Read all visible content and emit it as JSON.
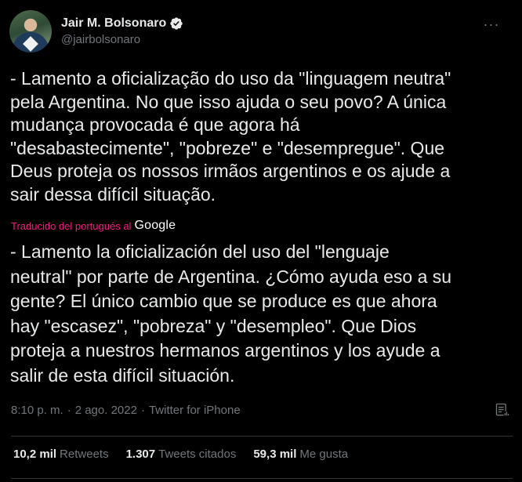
{
  "author": {
    "display_name": "Jair M. Bolsonaro",
    "handle": "@jairbolsonaro",
    "verified": true,
    "avatar_icon": "profile-photo"
  },
  "tweet": {
    "text": "- Lamento a oficialização do uso da \"linguagem neutra\"\npela Argentina. No que isso ajuda o seu povo? A única\nmudança provocada é que agora há\n\"desabastecimente\", \"pobreze\" e \"desempregue\". Que\nDeus proteja os nossos irmãos argentinos e os ajude a\nsair dessa difícil situação.",
    "translation_label": "Traducido del portugués al",
    "translation_provider": "Google",
    "translated_text": "- Lamento la oficialización del uso del \"lenguaje\nneutral\" por parte de Argentina. ¿Cómo ayuda eso a su\ngente? El único cambio que se produce es que ahora\nhay \"escasez\", \"pobreza\" y \"desempleo\". Que Dios\nproteja a nuestros hermanos argentinos y los ayude a\nsalir de esta difícil situación."
  },
  "meta": {
    "time": "8:10 p. m.",
    "separator": "·",
    "date": "2 ago. 2022",
    "source": "Twitter for iPhone"
  },
  "stats": [
    {
      "value": "10,2 mil",
      "label": "Retweets"
    },
    {
      "value": "1.307",
      "label": "Tweets citados"
    },
    {
      "value": "59,3 mil",
      "label": "Me gusta"
    }
  ],
  "more_menu": "···",
  "colors": {
    "background": "#000000",
    "text": "#e7e9ea",
    "secondary_text": "#71767b",
    "translation_accent": "#f91880",
    "divider": "#2f3336",
    "verified_badge": "#e7e9ea"
  }
}
